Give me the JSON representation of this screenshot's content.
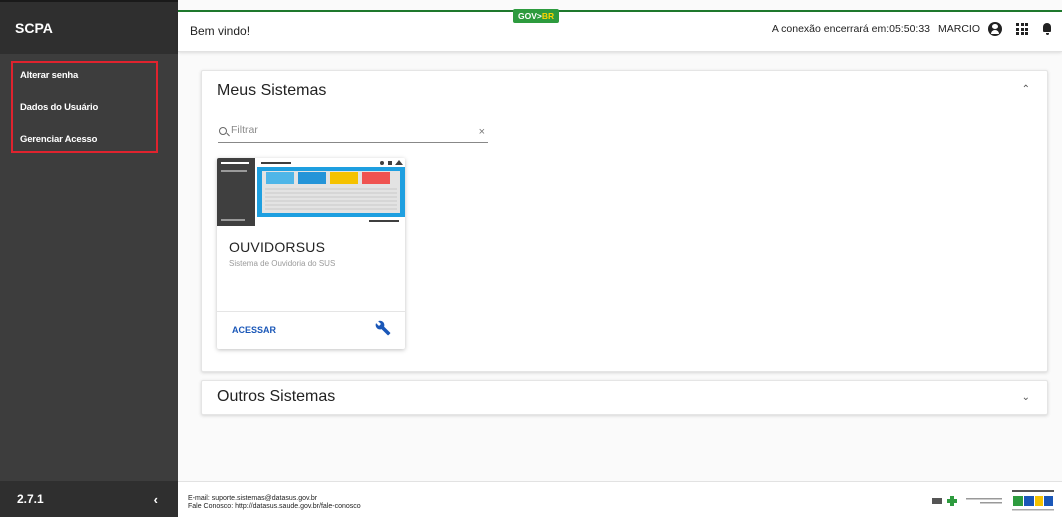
{
  "app": {
    "name": "SCPA",
    "version": "2.7.1"
  },
  "sidebar": {
    "items": [
      {
        "label": "Alterar senha"
      },
      {
        "label": "Dados do Usuário"
      },
      {
        "label": "Gerenciar Acesso"
      }
    ],
    "collapse_glyph": "‹"
  },
  "header": {
    "welcome": "Bem vindo!",
    "gov_logo": {
      "gov": "GOV",
      "sep": ">",
      "br": "BR"
    },
    "session_text": "A conexão encerrará em:05:50:33",
    "user": "MARCIO",
    "icons": [
      "user-icon",
      "apps-grid-icon",
      "bell-icon"
    ]
  },
  "meus_sistemas": {
    "title": "Meus Sistemas",
    "expanded": true,
    "filter": {
      "placeholder": "Filtrar",
      "value": "",
      "clear_glyph": "×"
    },
    "cards": [
      {
        "title": "OUVIDORSUS",
        "subtitle": "Sistema de Ouvidoria do SUS",
        "action_label": "ACESSAR"
      }
    ]
  },
  "outros_sistemas": {
    "title": "Outros Sistemas",
    "expanded": false
  },
  "footer": {
    "email_line": "E-mail: suporte.sistemas@datasus.gov.br",
    "contact_line": "Fale Conosco: http://datasus.saude.gov.br/fale-conosco",
    "logos": [
      "sus-logo",
      "ministerio-da-saude-logo",
      "governo-federal-logo"
    ]
  },
  "colors": {
    "sidebar_bg": "#3d3d3d",
    "highlight_border": "#e0232e",
    "accent_link": "#1a57b8",
    "gov_green": "#2d9b3e"
  }
}
